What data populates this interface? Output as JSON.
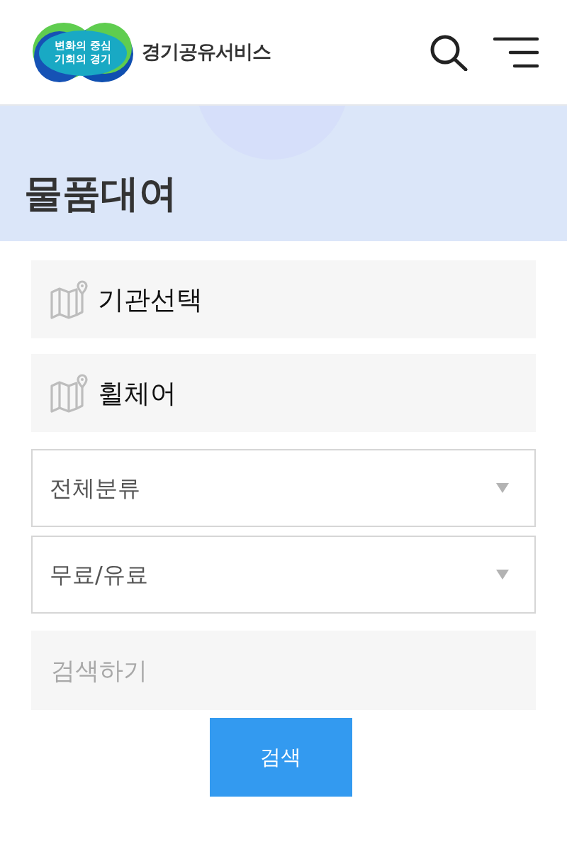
{
  "header": {
    "logo": {
      "slogan": [
        "변화의 중심",
        "기회의 경기"
      ],
      "name": "경기공유서비스"
    }
  },
  "page_title": "물품대여",
  "selectors": [
    {
      "kind": "location",
      "label": "기관선택"
    },
    {
      "kind": "location",
      "label": "휠체어"
    },
    {
      "kind": "dropdown",
      "label": "전체분류"
    },
    {
      "kind": "dropdown",
      "label": "무료/유료"
    }
  ],
  "search": {
    "placeholder": "검색하기",
    "button": "검색"
  }
}
